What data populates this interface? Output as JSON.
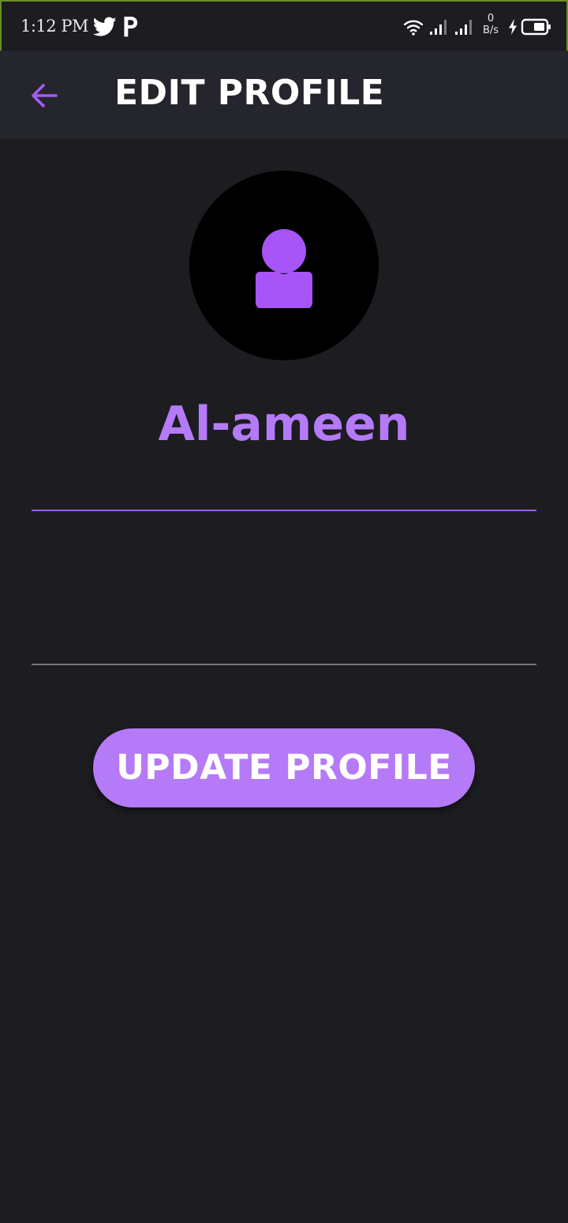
{
  "status_bar": {
    "time": "1:12 PM",
    "net_speed_value": "0",
    "net_speed_unit": "B/s",
    "icons": [
      "twitter-icon",
      "p-icon",
      "wifi-icon",
      "signal-icon",
      "signal-icon",
      "charging-icon",
      "battery-icon"
    ]
  },
  "app_bar": {
    "title": "EDIT PROFILE",
    "back_icon": "arrow-left-icon"
  },
  "profile": {
    "avatar_icon": "user-icon",
    "name": "Al-ameen"
  },
  "form": {
    "field_1_value": "",
    "field_2_value": ""
  },
  "actions": {
    "update_label": "UPDATE PROFILE"
  },
  "colors": {
    "accent": "#b57af7",
    "accent_line": "#a45cf5",
    "background": "#1c1c21",
    "app_bar": "#25262d",
    "avatar_bg": "#000000"
  }
}
